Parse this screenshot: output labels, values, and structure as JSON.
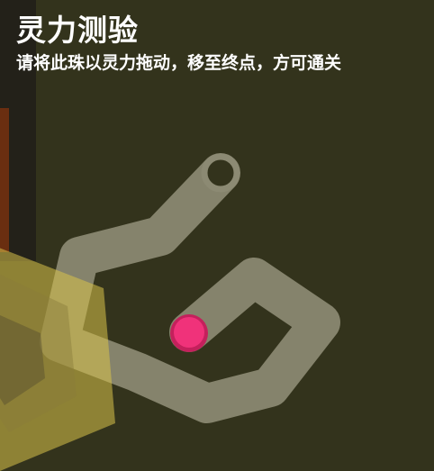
{
  "puzzle": {
    "title": "灵力测验",
    "instruction": "请将此珠以灵力拖动，移至终点，方可通关"
  },
  "colors": {
    "background": "#33331c",
    "path": "#8c8a73",
    "orb": "#f0327a",
    "orb_ring": "#c4205c",
    "goal_ring": "#8c8a73",
    "goal_hole": "#33331c",
    "seal": "#d9c24a"
  }
}
